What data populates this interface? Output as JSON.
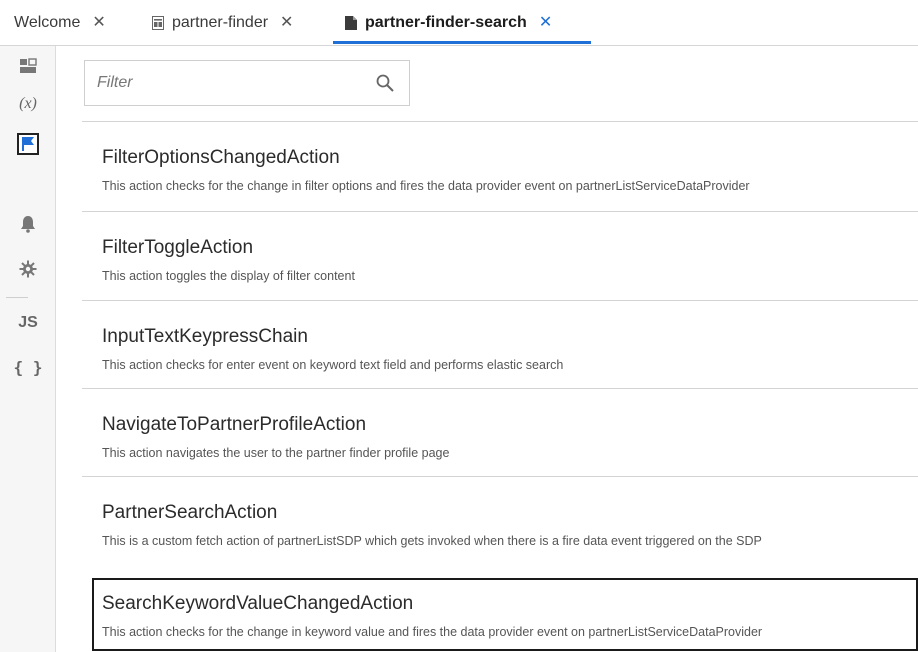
{
  "tabs": [
    {
      "label": "Welcome"
    },
    {
      "label": "partner-finder"
    },
    {
      "label": "partner-finder-search"
    }
  ],
  "rail": {
    "items": [
      {
        "icon": "layout-icon"
      },
      {
        "icon": "variables-icon",
        "text": "(x)"
      },
      {
        "icon": "flag-icon"
      },
      {
        "icon": "bell-icon"
      },
      {
        "icon": "gear-icon"
      },
      {
        "icon": "js-icon",
        "text": "JS"
      },
      {
        "icon": "json-icon",
        "text": "{ }"
      }
    ]
  },
  "filter": {
    "placeholder": "Filter",
    "value": ""
  },
  "actions": [
    {
      "title": "FilterOptionsChangedAction",
      "description": "This action checks for the change in filter options and fires the data provider event on partnerListServiceDataProvider"
    },
    {
      "title": "FilterToggleAction",
      "description": "This action toggles the display of filter content"
    },
    {
      "title": "InputTextKeypressChain",
      "description": "This action checks for enter event on keyword text field and performs elastic search"
    },
    {
      "title": "NavigateToPartnerProfileAction",
      "description": "This action navigates the user to the partner finder profile page"
    },
    {
      "title": "PartnerSearchAction",
      "description": "This is a custom fetch action of partnerListSDP which gets invoked when there is a fire data event triggered on the SDP"
    },
    {
      "title": "SearchKeywordValueChangedAction",
      "description": "This action checks for the change in keyword value and fires the data provider event on partnerListServiceDataProvider"
    }
  ],
  "colors": {
    "accent": "#1f6fd6",
    "flag": "#1f6fd6",
    "selected_border": "#1a1a1a"
  }
}
